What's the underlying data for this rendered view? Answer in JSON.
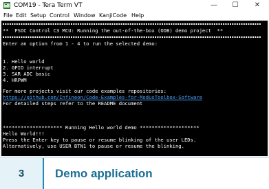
{
  "window": {
    "title": "COM19 - Tera Term VT",
    "controls": {
      "minimize": "—",
      "maximize": "☐",
      "close": "✕"
    },
    "app_icon": "tera-term-icon"
  },
  "menu": [
    "File",
    "Edit",
    "Setup",
    "Control",
    "Window",
    "KanjiCode",
    "Help"
  ],
  "terminal": {
    "banner": "**  PSOC Control C3 MCU: Running the out-of-the-box (OOB) demo project  **",
    "prompt": "Enter an option from 1 - 4 to run the selected demo:",
    "options": [
      "1. Hello world",
      "2. GPIO interrupt",
      "3. SAR ADC basic",
      "4. HRPWM"
    ],
    "more_projects": "For more projects visit our code examples repositories:",
    "link": "https://github.com/Infineon/Code-Examples-for-ModusToolbox-Software",
    "readme": "For detailed steps refer to the README document",
    "running": "******************** Running Hello world demo ********************",
    "hello": "Hello World!!!",
    "instruction1": "Press the Enter key to pause or resume blinking of the user LEDs.",
    "instruction2": "Alternatively, use USER BTN1 to pause or resume the blinking.",
    "colors": {
      "background": "#000000",
      "text": "#ffffff",
      "link": "#4aa3ff"
    }
  },
  "step": {
    "number": "3",
    "title": "Demo application",
    "colors": {
      "number_bg": "#e5f3f8",
      "accent": "#1e8bb4",
      "title": "#1a6f95"
    }
  }
}
